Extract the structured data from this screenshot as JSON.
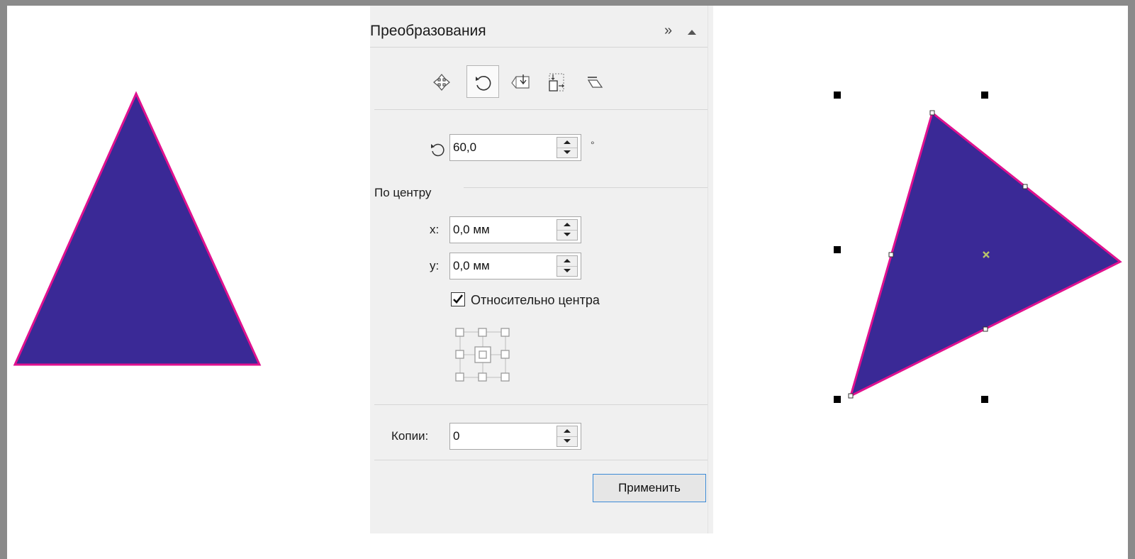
{
  "panel": {
    "title": "Преобразования",
    "expand_glyph": "»",
    "modes": [
      {
        "icon": "position-icon",
        "active": false
      },
      {
        "icon": "rotate-icon",
        "active": true
      },
      {
        "icon": "scale-mirror-icon",
        "active": false
      },
      {
        "icon": "size-icon",
        "active": false
      },
      {
        "icon": "skew-icon",
        "active": false
      }
    ],
    "rotation": {
      "icon": "rotate-icon",
      "value": "60,0",
      "unit": "°"
    },
    "center": {
      "section_label": "По центру",
      "x_label": "x:",
      "x_value": "0,0 мм",
      "y_label": "y:",
      "y_value": "0,0 мм",
      "relative_label": "Относительно центра",
      "relative_checked": true,
      "anchor_icon": "anchor-grid-icon"
    },
    "copies": {
      "label": "Копии:",
      "value": "0"
    },
    "apply_label": "Применить"
  },
  "colors": {
    "triangle_fill": "#3a2996",
    "triangle_outline": "#e0118f",
    "center_marker": "#b7c26b",
    "apply_border": "#3c8ad6"
  }
}
